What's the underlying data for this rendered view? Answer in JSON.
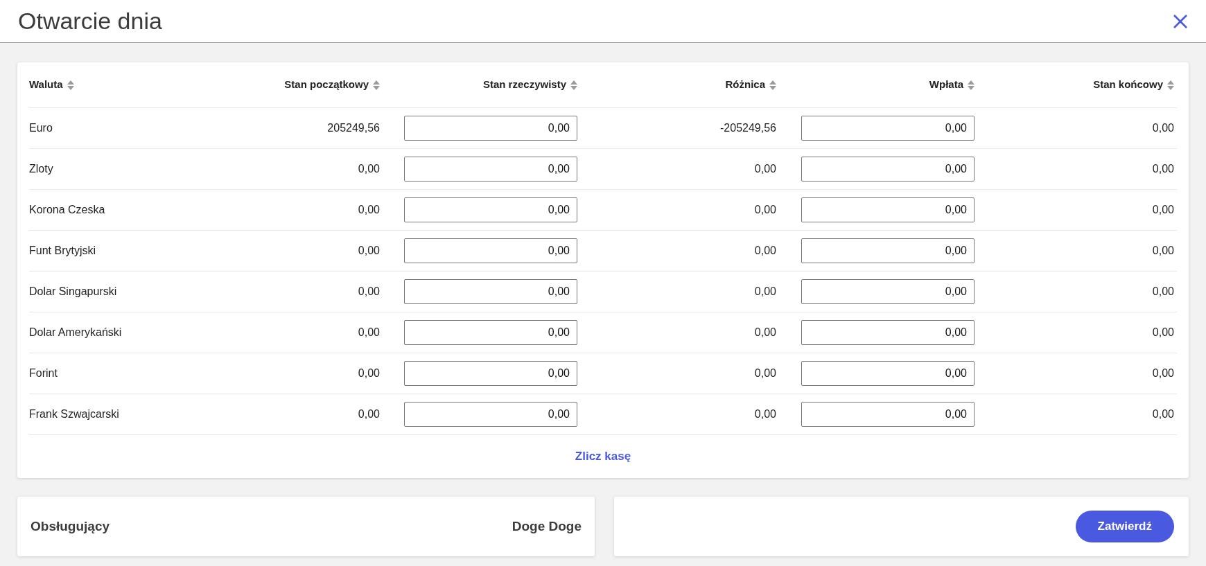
{
  "window": {
    "title": "Otwarcie dnia"
  },
  "table": {
    "columns": [
      "Waluta",
      "Stan początkowy",
      "Stan rzeczywisty",
      "Różnica",
      "Wpłata",
      "Stan końcowy"
    ],
    "rows": [
      {
        "currency": "Euro",
        "opening": "205249,56",
        "actual": "0,00",
        "difference": "-205249,56",
        "deposit": "0,00",
        "closing": "0,00"
      },
      {
        "currency": "Zloty",
        "opening": "0,00",
        "actual": "0,00",
        "difference": "0,00",
        "deposit": "0,00",
        "closing": "0,00"
      },
      {
        "currency": "Korona Czeska",
        "opening": "0,00",
        "actual": "0,00",
        "difference": "0,00",
        "deposit": "0,00",
        "closing": "0,00"
      },
      {
        "currency": "Funt Brytyjski",
        "opening": "0,00",
        "actual": "0,00",
        "difference": "0,00",
        "deposit": "0,00",
        "closing": "0,00"
      },
      {
        "currency": "Dolar Singapurski",
        "opening": "0,00",
        "actual": "0,00",
        "difference": "0,00",
        "deposit": "0,00",
        "closing": "0,00"
      },
      {
        "currency": "Dolar Amerykański",
        "opening": "0,00",
        "actual": "0,00",
        "difference": "0,00",
        "deposit": "0,00",
        "closing": "0,00"
      },
      {
        "currency": "Forint",
        "opening": "0,00",
        "actual": "0,00",
        "difference": "0,00",
        "deposit": "0,00",
        "closing": "0,00"
      },
      {
        "currency": "Frank Szwajcarski",
        "opening": "0,00",
        "actual": "0,00",
        "difference": "0,00",
        "deposit": "0,00",
        "closing": "0,00"
      }
    ],
    "count_link": "Zlicz kasę"
  },
  "operator": {
    "label": "Obsługujący",
    "name": "Doge Doge"
  },
  "confirm_button": "Zatwierdź"
}
